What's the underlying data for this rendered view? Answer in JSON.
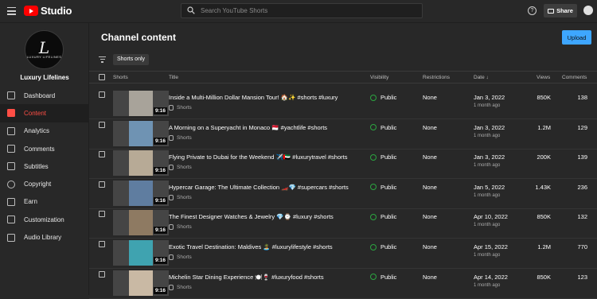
{
  "topbar": {
    "logo_text": "Studio",
    "search_placeholder": "Search YouTube Shorts",
    "help_glyph": "?",
    "share_label": "Share"
  },
  "sidebar": {
    "channel_logo_letter": "L",
    "channel_logo_text": "LUXURY LIFELINES",
    "channel_name": "Luxury Lifelines",
    "items": [
      {
        "label": "Dashboard",
        "icon": "dashboard-icon",
        "active": false
      },
      {
        "label": "Content",
        "icon": "content-icon",
        "active": true
      },
      {
        "label": "Analytics",
        "icon": "analytics-icon",
        "active": false
      },
      {
        "label": "Comments",
        "icon": "comments-icon",
        "active": false
      },
      {
        "label": "Subtitles",
        "icon": "subtitles-icon",
        "active": false
      },
      {
        "label": "Copyright",
        "icon": "copyright-icon",
        "active": false
      },
      {
        "label": "Earn",
        "icon": "earn-icon",
        "active": false
      },
      {
        "label": "Customization",
        "icon": "customization-icon",
        "active": false
      },
      {
        "label": "Audio Library",
        "icon": "audio-library-icon",
        "active": false
      }
    ]
  },
  "main": {
    "title": "Channel content",
    "upload_label": "Upload",
    "filter_chip": "Shorts only",
    "columns": {
      "shorts": "Shorts",
      "title": "Title",
      "visibility": "Visibility",
      "restrictions": "Restrictions",
      "date": "Date ↓",
      "views": "Views",
      "comments": "Comments"
    },
    "rows": [
      {
        "title": "Inside a Multi-Million Dollar Mansion Tour! 🏠✨ #shorts #luxury",
        "type": "Shorts",
        "duration": "9:16",
        "visibility": "Public",
        "restrictions": "None",
        "date": "Jan 3, 2022",
        "ago": "1 month ago",
        "views": "850K",
        "comments": "138",
        "thumb_color": "#a8a39a"
      },
      {
        "title": "A Morning on a Superyacht in Monaco 🇲🇨 #yachtlife #shorts",
        "type": "Shorts",
        "duration": "9:16",
        "visibility": "Public",
        "restrictions": "None",
        "date": "Jan 3, 2022",
        "ago": "1 month ago",
        "views": "1.2M",
        "comments": "129",
        "thumb_color": "#6f93b3"
      },
      {
        "title": "Flying Private to Dubai for the Weekend ✈️🇦🇪 #luxurytravel #shorts",
        "type": "Shorts",
        "duration": "9:16",
        "visibility": "Public",
        "restrictions": "None",
        "date": "Jan 3, 2022",
        "ago": "1 month ago",
        "views": "200K",
        "comments": "139",
        "thumb_color": "#b7aa96"
      },
      {
        "title": "Hypercar Garage: The Ultimate Collection 🏎️💎 #supercars #shorts",
        "type": "Shorts",
        "duration": "9:16",
        "visibility": "Public",
        "restrictions": "None",
        "date": "Jan 5, 2022",
        "ago": "1 month ago",
        "views": "1.43K",
        "comments": "236",
        "thumb_color": "#5f7da0"
      },
      {
        "title": "The Finest Designer Watches & Jewelry 💎⌚ #luxury #shorts",
        "type": "Shorts",
        "duration": "9:16",
        "visibility": "Public",
        "restrictions": "None",
        "date": "Apr 10, 2022",
        "ago": "1 month ago",
        "views": "850K",
        "comments": "132",
        "thumb_color": "#8e7a62"
      },
      {
        "title": "Exotic Travel Destination: Maldives 🏝️ #luxurylifestyle #shorts",
        "type": "Shorts",
        "duration": "9:16",
        "visibility": "Public",
        "restrictions": "None",
        "date": "Apr 15, 2022",
        "ago": "1 month ago",
        "views": "1.2M",
        "comments": "770",
        "thumb_color": "#3fa3b0"
      },
      {
        "title": "Michelin Star Dining Experience 🍽️🍷 #luxuryfood #shorts",
        "type": "Shorts",
        "duration": "9:16",
        "visibility": "Public",
        "restrictions": "None",
        "date": "Apr 14, 2022",
        "ago": "1 month ago",
        "views": "850K",
        "comments": "123",
        "thumb_color": "#c9b9a4"
      }
    ]
  },
  "colors": {
    "brand_red": "#ff0000",
    "active_red": "#ff4e45",
    "upload_blue": "#3ea6ff",
    "public_green": "#2ba640"
  }
}
